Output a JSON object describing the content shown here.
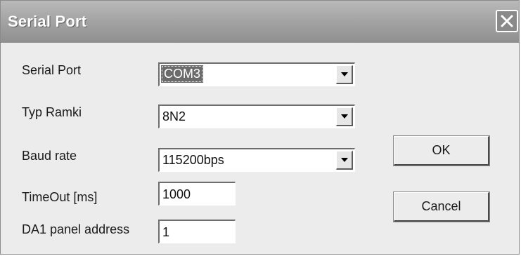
{
  "window": {
    "title": "Serial Port",
    "close_icon": "close-icon"
  },
  "form": {
    "serial_port": {
      "label": "Serial Port",
      "value": "COM3"
    },
    "frame_type": {
      "label": "Typ Ramki",
      "value": "8N2"
    },
    "baud_rate": {
      "label": "Baud rate",
      "value": "115200bps"
    },
    "timeout": {
      "label": "TimeOut [ms]",
      "value": "1000"
    },
    "panel_address": {
      "label": "DA1 panel address",
      "value": "1"
    }
  },
  "buttons": {
    "ok_label": "OK",
    "cancel_label": "Cancel"
  }
}
